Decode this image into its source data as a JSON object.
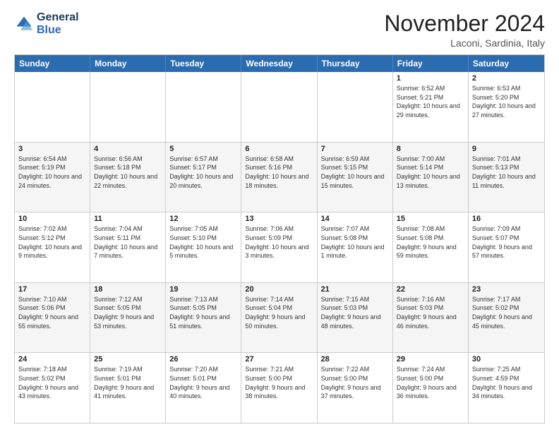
{
  "logo": {
    "line1": "General",
    "line2": "Blue"
  },
  "title": "November 2024",
  "subtitle": "Laconi, Sardinia, Italy",
  "headers": [
    "Sunday",
    "Monday",
    "Tuesday",
    "Wednesday",
    "Thursday",
    "Friday",
    "Saturday"
  ],
  "rows": [
    [
      {
        "day": "",
        "info": ""
      },
      {
        "day": "",
        "info": ""
      },
      {
        "day": "",
        "info": ""
      },
      {
        "day": "",
        "info": ""
      },
      {
        "day": "",
        "info": ""
      },
      {
        "day": "1",
        "info": "Sunrise: 6:52 AM\nSunset: 5:21 PM\nDaylight: 10 hours and 29 minutes."
      },
      {
        "day": "2",
        "info": "Sunrise: 6:53 AM\nSunset: 5:20 PM\nDaylight: 10 hours and 27 minutes."
      }
    ],
    [
      {
        "day": "3",
        "info": "Sunrise: 6:54 AM\nSunset: 5:19 PM\nDaylight: 10 hours and 24 minutes."
      },
      {
        "day": "4",
        "info": "Sunrise: 6:56 AM\nSunset: 5:18 PM\nDaylight: 10 hours and 22 minutes."
      },
      {
        "day": "5",
        "info": "Sunrise: 6:57 AM\nSunset: 5:17 PM\nDaylight: 10 hours and 20 minutes."
      },
      {
        "day": "6",
        "info": "Sunrise: 6:58 AM\nSunset: 5:16 PM\nDaylight: 10 hours and 18 minutes."
      },
      {
        "day": "7",
        "info": "Sunrise: 6:59 AM\nSunset: 5:15 PM\nDaylight: 10 hours and 15 minutes."
      },
      {
        "day": "8",
        "info": "Sunrise: 7:00 AM\nSunset: 5:14 PM\nDaylight: 10 hours and 13 minutes."
      },
      {
        "day": "9",
        "info": "Sunrise: 7:01 AM\nSunset: 5:13 PM\nDaylight: 10 hours and 11 minutes."
      }
    ],
    [
      {
        "day": "10",
        "info": "Sunrise: 7:02 AM\nSunset: 5:12 PM\nDaylight: 10 hours and 9 minutes."
      },
      {
        "day": "11",
        "info": "Sunrise: 7:04 AM\nSunset: 5:11 PM\nDaylight: 10 hours and 7 minutes."
      },
      {
        "day": "12",
        "info": "Sunrise: 7:05 AM\nSunset: 5:10 PM\nDaylight: 10 hours and 5 minutes."
      },
      {
        "day": "13",
        "info": "Sunrise: 7:06 AM\nSunset: 5:09 PM\nDaylight: 10 hours and 3 minutes."
      },
      {
        "day": "14",
        "info": "Sunrise: 7:07 AM\nSunset: 5:08 PM\nDaylight: 10 hours and 1 minute."
      },
      {
        "day": "15",
        "info": "Sunrise: 7:08 AM\nSunset: 5:08 PM\nDaylight: 9 hours and 59 minutes."
      },
      {
        "day": "16",
        "info": "Sunrise: 7:09 AM\nSunset: 5:07 PM\nDaylight: 9 hours and 57 minutes."
      }
    ],
    [
      {
        "day": "17",
        "info": "Sunrise: 7:10 AM\nSunset: 5:06 PM\nDaylight: 9 hours and 55 minutes."
      },
      {
        "day": "18",
        "info": "Sunrise: 7:12 AM\nSunset: 5:05 PM\nDaylight: 9 hours and 53 minutes."
      },
      {
        "day": "19",
        "info": "Sunrise: 7:13 AM\nSunset: 5:05 PM\nDaylight: 9 hours and 51 minutes."
      },
      {
        "day": "20",
        "info": "Sunrise: 7:14 AM\nSunset: 5:04 PM\nDaylight: 9 hours and 50 minutes."
      },
      {
        "day": "21",
        "info": "Sunrise: 7:15 AM\nSunset: 5:03 PM\nDaylight: 9 hours and 48 minutes."
      },
      {
        "day": "22",
        "info": "Sunrise: 7:16 AM\nSunset: 5:03 PM\nDaylight: 9 hours and 46 minutes."
      },
      {
        "day": "23",
        "info": "Sunrise: 7:17 AM\nSunset: 5:02 PM\nDaylight: 9 hours and 45 minutes."
      }
    ],
    [
      {
        "day": "24",
        "info": "Sunrise: 7:18 AM\nSunset: 5:02 PM\nDaylight: 9 hours and 43 minutes."
      },
      {
        "day": "25",
        "info": "Sunrise: 7:19 AM\nSunset: 5:01 PM\nDaylight: 9 hours and 41 minutes."
      },
      {
        "day": "26",
        "info": "Sunrise: 7:20 AM\nSunset: 5:01 PM\nDaylight: 9 hours and 40 minutes."
      },
      {
        "day": "27",
        "info": "Sunrise: 7:21 AM\nSunset: 5:00 PM\nDaylight: 9 hours and 38 minutes."
      },
      {
        "day": "28",
        "info": "Sunrise: 7:22 AM\nSunset: 5:00 PM\nDaylight: 9 hours and 37 minutes."
      },
      {
        "day": "29",
        "info": "Sunrise: 7:24 AM\nSunset: 5:00 PM\nDaylight: 9 hours and 36 minutes."
      },
      {
        "day": "30",
        "info": "Sunrise: 7:25 AM\nSunset: 4:59 PM\nDaylight: 9 hours and 34 minutes."
      }
    ]
  ]
}
